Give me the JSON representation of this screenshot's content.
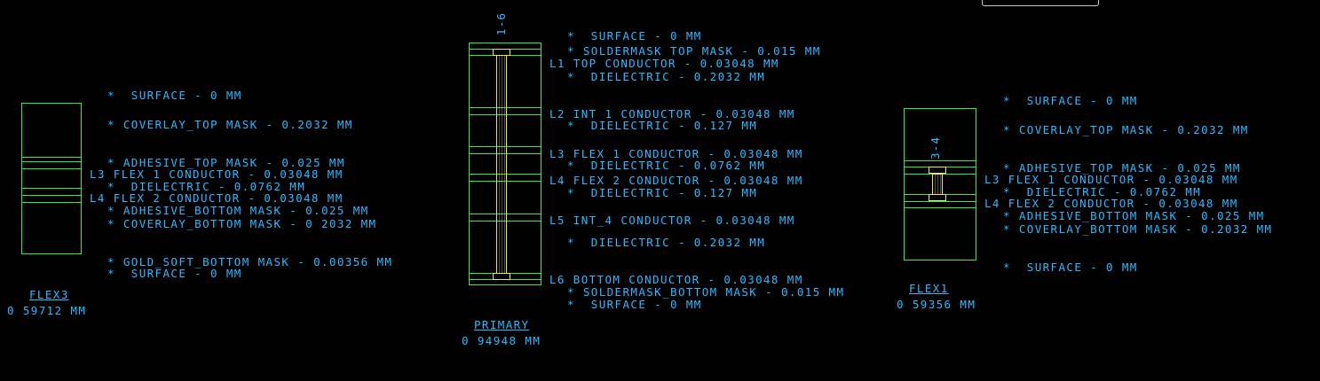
{
  "stackups": {
    "flex3": {
      "name": "FLEX3",
      "thickness": "0 59712 MM",
      "layers": [
        "*  SURFACE - 0 MM",
        "* COVERLAY_TOP MASK - 0.2032 MM",
        "* ADHESIVE_TOP MASK - 0.025 MM",
        "L3 FLEX 1 CONDUCTOR - 0.03048 MM",
        "*  DIELECTRIC - 0.0762 MM",
        "L4 FLEX 2 CONDUCTOR - 0.03048 MM",
        "* ADHESIVE_BOTTOM MASK - 0.025 MM",
        "* COVERLAY_BOTTOM MASK - 0 2032 MM",
        "* GOLD_SOFT_BOTTOM MASK - 0.00356 MM",
        "*  SURFACE - 0 MM"
      ]
    },
    "primary": {
      "name": "PRIMARY",
      "thickness": "0 94948 MM",
      "span": "1-6",
      "layers": [
        "*  SURFACE - 0 MM",
        "* SOLDERMASK TOP MASK - 0.015 MM",
        "L1 TOP CONDUCTOR - 0.03048 MM",
        "*  DIELECTRIC - 0.2032 MM",
        "L2 INT 1 CONDUCTOR - 0.03048 MM",
        "*  DIELECTRIC - 0.127 MM",
        "L3 FLEX 1 CONDUCTOR - 0.03048 MM",
        "*  DIELECTRIC - 0.0762 MM",
        "L4 FLEX 2 CONDUCTOR - 0.03048 MM",
        "*  DIELECTRIC - 0.127 MM",
        "L5 INT_4 CONDUCTOR - 0.03048 MM",
        "*  DIELECTRIC - 0.2032 MM",
        "L6 BOTTOM CONDUCTOR - 0.03048 MM",
        "* SOLDERMASK_BOTTOM MASK - 0.015 MM",
        "*  SURFACE - 0 MM"
      ]
    },
    "flex1": {
      "name": "FLEX1",
      "thickness": "0 59356 MM",
      "span": "3-4",
      "layers": [
        "*  SURFACE - 0 MM",
        "* COVERLAY_TOP MASK - 0.2032 MM",
        "* ADHESIVE_TOP MASK - 0.025 MM",
        "L3 FLEX 1 CONDUCTOR - 0.03048 MM",
        "*  DIELECTRIC - 0.0762 MM",
        "L4 FLEX 2 CONDUCTOR - 0.03048 MM",
        "* ADHESIVE_BOTTOM MASK - 0.025 MM",
        "* COVERLAY_BOTTOM MASK - 0.2032 MM",
        "*  SURFACE - 0 MM"
      ]
    }
  },
  "colors": {
    "text": "#2fb8ff",
    "outline": "#37e84a",
    "via": "#f0e65a",
    "background": "#000000"
  }
}
